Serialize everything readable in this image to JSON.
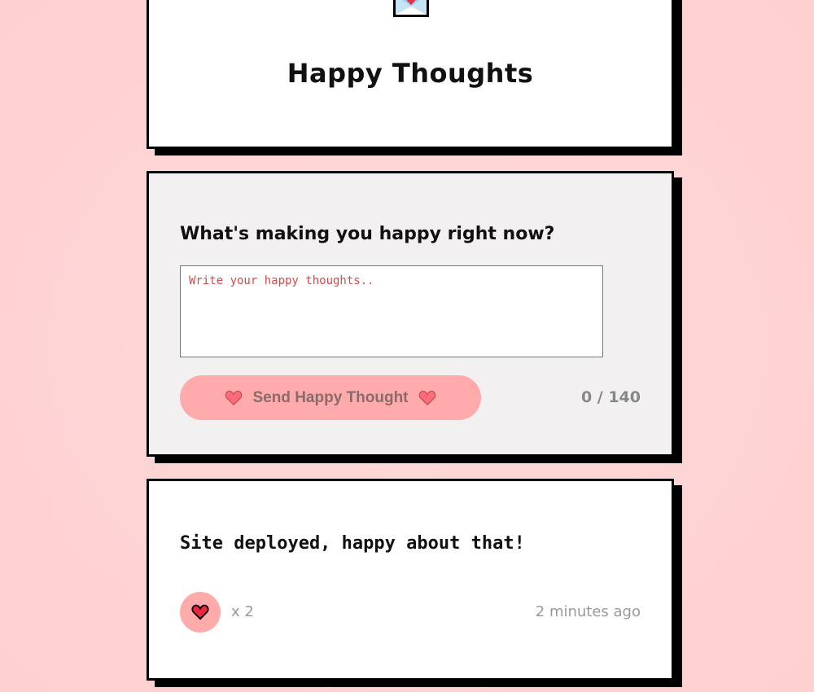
{
  "header": {
    "title": "Happy Thoughts",
    "logo_icon": "envelope-heart-icon"
  },
  "form": {
    "prompt": "What's making you happy right now?",
    "textarea_placeholder": "Write your happy thoughts..",
    "textarea_value": "",
    "send_label": "Send Happy Thought",
    "send_icon": "heart-icon",
    "char_count": "0 / 140"
  },
  "thoughts": [
    {
      "message": "Site deployed, happy about that!",
      "like_icon": "heart-icon",
      "likes": "x 2",
      "time": "2 minutes ago"
    }
  ],
  "colors": {
    "background": "#ffd0d0",
    "button": "#ffabab",
    "heart": "#ff5c6c",
    "card": "#ffffff",
    "form_card": "#f2f0f0"
  }
}
